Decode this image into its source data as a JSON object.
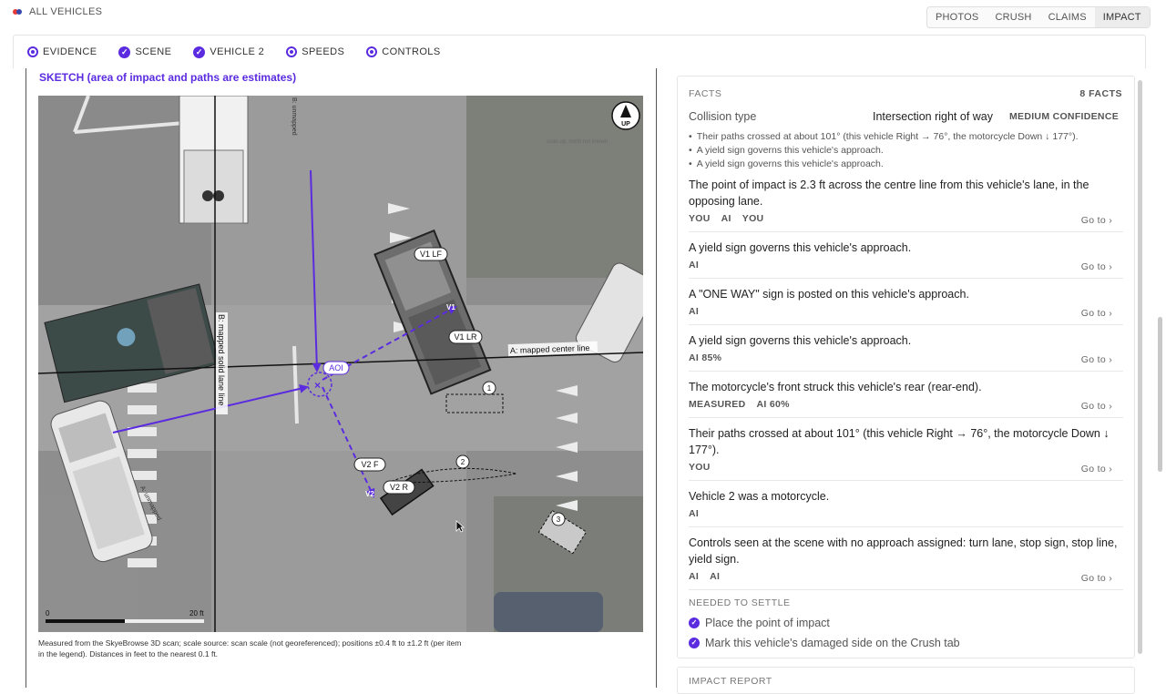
{
  "topbar": {
    "back_label": "ALL VEHICLES",
    "tabs": [
      {
        "label": "PHOTOS",
        "active": false
      },
      {
        "label": "CRUSH",
        "active": false
      },
      {
        "label": "CLAIMS",
        "active": false
      },
      {
        "label": "IMPACT",
        "active": true
      }
    ]
  },
  "steps": [
    {
      "label": "EVIDENCE",
      "state": "current"
    },
    {
      "label": "SCENE",
      "state": "done"
    },
    {
      "label": "VEHICLE 2",
      "state": "done"
    },
    {
      "label": "SPEEDS",
      "state": "current"
    },
    {
      "label": "CONTROLS",
      "state": "current"
    }
  ],
  "sketch": {
    "title": "SKETCH (area of impact and paths are estimates)",
    "north_label": "UP",
    "north_note": "scan up, north not known",
    "labels": {
      "v1lf": "V1 LF",
      "v1lr": "V1 LR",
      "v1": "V1",
      "v2f": "V2 F",
      "v2r": "V2 R",
      "v2": "V2",
      "aoi": "AOI",
      "center_line": "A: mapped center line",
      "solid_lane": "B: mapped solid lane line",
      "left_road": "A: unmapped",
      "top_road": "B: unmapped",
      "e1": "1",
      "e2": "2",
      "e3": "3",
      "scale_start": "0",
      "scale_end": "20 ft"
    },
    "caption": "Measured from the SkyeBrowse 3D scan; scale source: scan scale (not georeferenced); positions ±0.4 ft to ±1.2 ft (per item in the legend). Distances in feet to the nearest 0.1 ft."
  },
  "facts": {
    "header": "FACTS",
    "count": "8 FACTS",
    "collision_type_label": "Collision type",
    "collision_type_value": "Intersection right of way",
    "confidence": "MEDIUM CONFIDENCE",
    "bullets": [
      "Their paths crossed at about 101° (this vehicle Right → 76°, the motorcycle Down ↓ 177°).",
      "A yield sign governs this vehicle's approach.",
      "A yield sign governs this vehicle's approach."
    ],
    "goto_label": "Go to ›",
    "items": [
      {
        "text": "The point of impact is 2.3 ft across the centre line from this vehicle's lane, in the opposing lane.",
        "tags": [
          "YOU",
          "AI",
          "YOU"
        ]
      },
      {
        "text": "A yield sign governs this vehicle's approach.",
        "tags": [
          "AI"
        ]
      },
      {
        "text": "A \"ONE WAY\" sign is posted on this vehicle's approach.",
        "tags": [
          "AI"
        ]
      },
      {
        "text": "A yield sign governs this vehicle's approach.",
        "tags": [
          "AI 85%"
        ]
      },
      {
        "text": "The motorcycle's front struck this vehicle's rear (rear-end).",
        "tags": [
          "MEASURED",
          "AI 60%"
        ]
      },
      {
        "text": "Their paths crossed at about 101° (this vehicle Right → 76°, the motorcycle Down ↓ 177°).",
        "tags": [
          "YOU"
        ]
      },
      {
        "text": "Vehicle 2 was a motorcycle.",
        "tags": [
          "AI"
        ],
        "no_goto": true
      },
      {
        "text": "Controls seen at the scene with no approach assigned: turn lane, stop sign, stop line, yield sign.",
        "tags": [
          "AI",
          "AI"
        ]
      }
    ]
  },
  "needed": {
    "header": "NEEDED TO SETTLE",
    "items": [
      "Place the point of impact",
      "Mark this vehicle's damaged side on the Crush tab"
    ]
  },
  "impact_report": "IMPACT REPORT",
  "colors": {
    "accent": "#5b2be0"
  }
}
